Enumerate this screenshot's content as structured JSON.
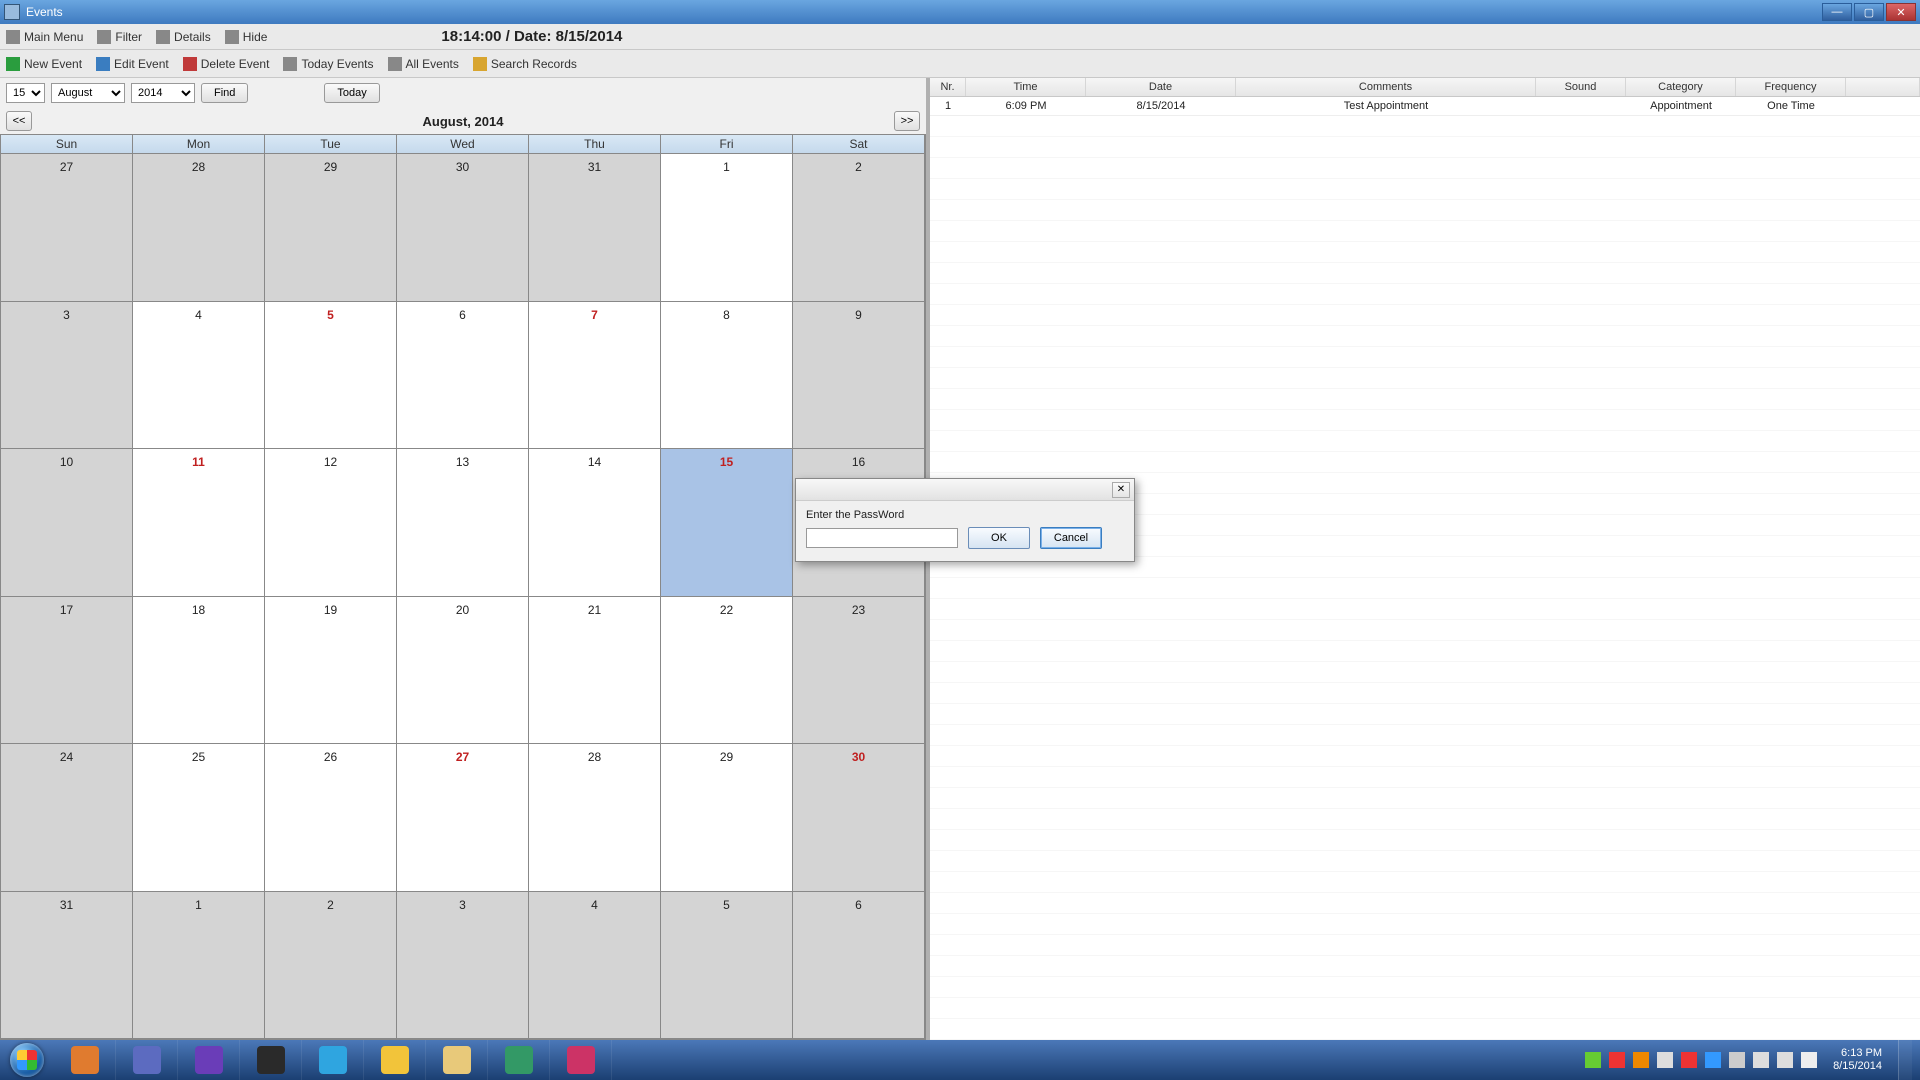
{
  "titlebar": {
    "title": "Events"
  },
  "menubar": {
    "main_menu": "Main Menu",
    "filter": "Filter",
    "details": "Details",
    "hide": "Hide",
    "clock": "18:14:00 / Date: 8/15/2014"
  },
  "toolbar": {
    "new_event": "New Event",
    "edit_event": "Edit Event",
    "delete_event": "Delete Event",
    "today_events": "Today Events",
    "all_events": "All Events",
    "search_records": "Search Records"
  },
  "datebar": {
    "day": "15",
    "month": "August",
    "year": "2014",
    "find": "Find",
    "today": "Today"
  },
  "nav": {
    "prev": "<<",
    "month_label": "August, 2014",
    "next": ">>"
  },
  "dayheaders": [
    "Sun",
    "Mon",
    "Tue",
    "Wed",
    "Thu",
    "Fri",
    "Sat"
  ],
  "weeks": [
    [
      {
        "n": "27",
        "cls": "outmonth"
      },
      {
        "n": "28",
        "cls": "outmonth"
      },
      {
        "n": "29",
        "cls": "outmonth"
      },
      {
        "n": "30",
        "cls": "outmonth"
      },
      {
        "n": "31",
        "cls": "outmonth"
      },
      {
        "n": "1",
        "cls": ""
      },
      {
        "n": "2",
        "cls": "weekend"
      }
    ],
    [
      {
        "n": "3",
        "cls": "weekend"
      },
      {
        "n": "4",
        "cls": ""
      },
      {
        "n": "5",
        "cls": "redday"
      },
      {
        "n": "6",
        "cls": ""
      },
      {
        "n": "7",
        "cls": "redday"
      },
      {
        "n": "8",
        "cls": ""
      },
      {
        "n": "9",
        "cls": "weekend"
      }
    ],
    [
      {
        "n": "10",
        "cls": "weekend"
      },
      {
        "n": "11",
        "cls": "redday"
      },
      {
        "n": "12",
        "cls": ""
      },
      {
        "n": "13",
        "cls": ""
      },
      {
        "n": "14",
        "cls": ""
      },
      {
        "n": "15",
        "cls": "today"
      },
      {
        "n": "16",
        "cls": "weekend"
      }
    ],
    [
      {
        "n": "17",
        "cls": "weekend"
      },
      {
        "n": "18",
        "cls": ""
      },
      {
        "n": "19",
        "cls": ""
      },
      {
        "n": "20",
        "cls": ""
      },
      {
        "n": "21",
        "cls": ""
      },
      {
        "n": "22",
        "cls": ""
      },
      {
        "n": "23",
        "cls": "weekend"
      }
    ],
    [
      {
        "n": "24",
        "cls": "weekend"
      },
      {
        "n": "25",
        "cls": ""
      },
      {
        "n": "26",
        "cls": ""
      },
      {
        "n": "27",
        "cls": "redday"
      },
      {
        "n": "28",
        "cls": ""
      },
      {
        "n": "29",
        "cls": ""
      },
      {
        "n": "30",
        "cls": "weekend redday"
      }
    ],
    [
      {
        "n": "31",
        "cls": "weekend"
      },
      {
        "n": "1",
        "cls": "outmonth"
      },
      {
        "n": "2",
        "cls": "outmonth"
      },
      {
        "n": "3",
        "cls": "outmonth"
      },
      {
        "n": "4",
        "cls": "outmonth"
      },
      {
        "n": "5",
        "cls": "outmonth"
      },
      {
        "n": "6",
        "cls": "outmonth"
      }
    ]
  ],
  "list": {
    "headers": {
      "nr": "Nr.",
      "time": "Time",
      "date": "Date",
      "comments": "Comments",
      "sound": "Sound",
      "category": "Category",
      "frequency": "Frequency"
    },
    "rows": [
      {
        "nr": "1",
        "time": "6:09 PM",
        "date": "8/15/2014",
        "comments": "Test Appointment",
        "sound": "",
        "category": "Appointment",
        "frequency": "One Time"
      }
    ]
  },
  "modal": {
    "label": "Enter the  PassWord",
    "ok": "OK",
    "cancel": "Cancel",
    "close": "✕"
  },
  "taskbar": {
    "icons": [
      {
        "name": "firefox-icon",
        "bg": "#e07b2f"
      },
      {
        "name": "infinity-icon",
        "bg": "#5c6bc0"
      },
      {
        "name": "visualstudio-icon",
        "bg": "#6a3db8"
      },
      {
        "name": "record-icon",
        "bg": "#2a2a2a"
      },
      {
        "name": "skype-icon",
        "bg": "#2fa5e0"
      },
      {
        "name": "sun-icon",
        "bg": "#f2c43a"
      },
      {
        "name": "explorer-icon",
        "bg": "#e8c97a"
      },
      {
        "name": "app1-icon",
        "bg": "#396"
      },
      {
        "name": "app2-icon",
        "bg": "#c36"
      }
    ],
    "tray_icons": [
      {
        "name": "tray-1",
        "bg": "#6c3"
      },
      {
        "name": "tray-2",
        "bg": "#e33"
      },
      {
        "name": "tray-3",
        "bg": "#e80"
      },
      {
        "name": "volume-icon",
        "bg": "#ddd"
      },
      {
        "name": "tray-flag",
        "bg": "#e33"
      },
      {
        "name": "tray-5",
        "bg": "#39f"
      },
      {
        "name": "tray-up",
        "bg": "#ccc"
      },
      {
        "name": "network-icon",
        "bg": "#ddd"
      },
      {
        "name": "battery-icon",
        "bg": "#ddd"
      },
      {
        "name": "action-icon",
        "bg": "#eee"
      }
    ],
    "clock_time": "6:13 PM",
    "clock_date": "8/15/2014"
  }
}
